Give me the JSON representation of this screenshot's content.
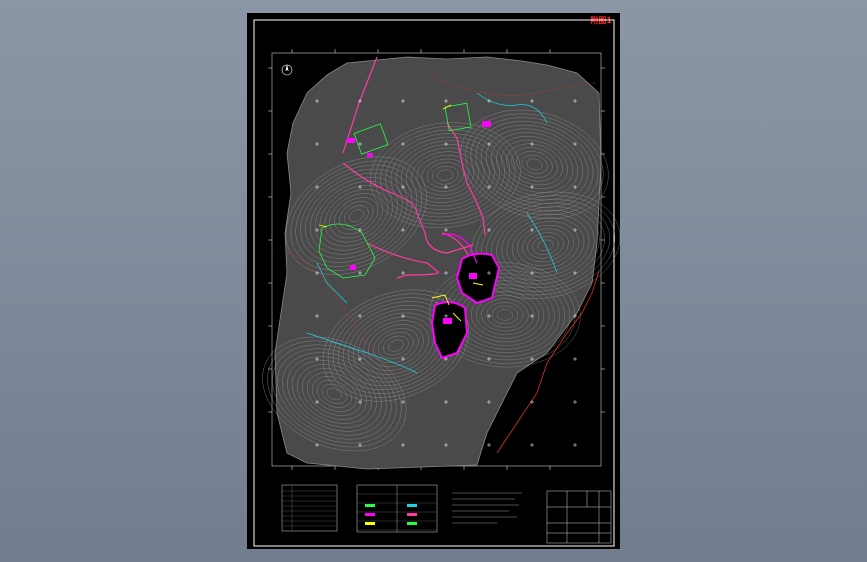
{
  "drawing": {
    "sheet_tag": "附图1",
    "north_arrow_icon": "north-arrow-icon",
    "colors": {
      "background": "#000000",
      "frame": "#ffffff",
      "contours": "#8a8a8a",
      "road": "#ff3aa0",
      "boundary": "#ff00ff",
      "facility": "#22ff44",
      "water": "#19d5e8",
      "highlight": "#ffff00",
      "fault": "#e03030"
    }
  }
}
